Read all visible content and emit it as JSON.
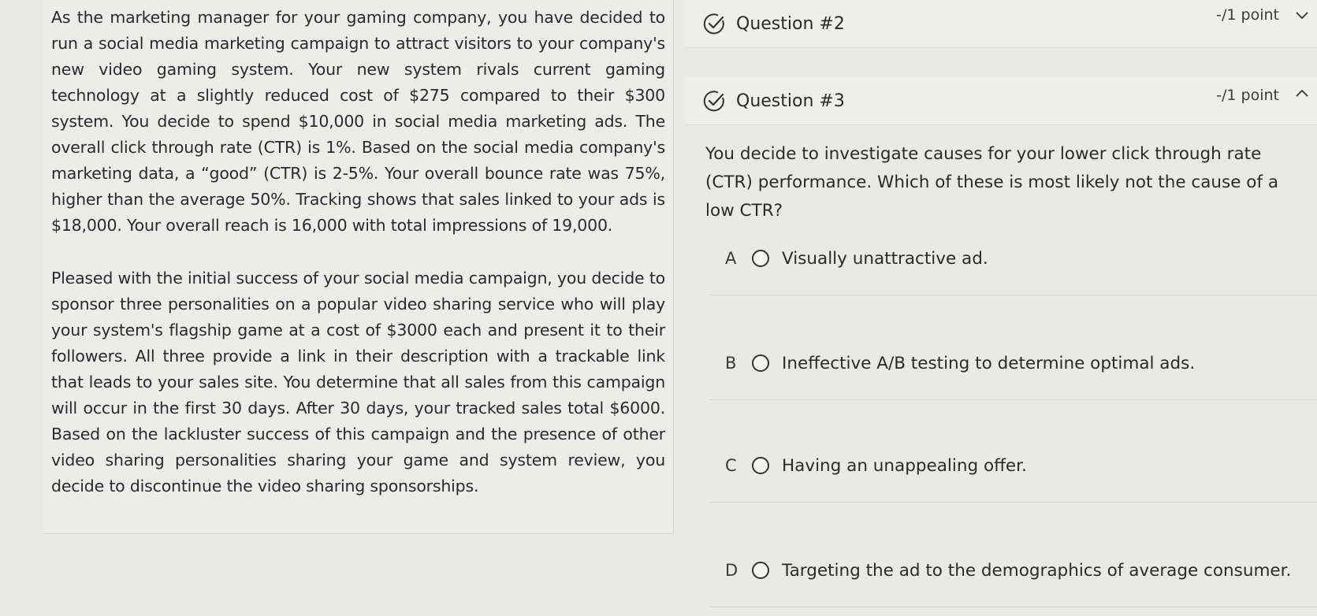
{
  "passage": {
    "paragraph_1": "As the marketing manager for your gaming company, you have decided to run a social media marketing campaign to attract visitors to your company's new video gaming system. Your new system rivals current gaming technology at a slightly reduced cost of $275 compared to their $300 system. You decide to spend $10,000 in social media marketing ads. The overall click through rate (CTR) is 1%. Based on the social media company's marketing data, a “good” (CTR) is 2-5%. Your overall bounce rate was 75%, higher than the average 50%. Tracking shows that sales linked to your ads is $18,000. Your overall reach is 16,000 with total impressions of 19,000.",
    "paragraph_2": "Pleased with the initial success of your social media campaign, you decide to sponsor three personalities on a popular video sharing service who will play your system's flagship game at a cost of $3000 each and present it to their followers. All three provide a link in their description with a trackable link that leads to your sales site. You determine that all sales from this campaign will occur in the first 30 days. After 30 days, your tracked sales total $6000. Based on the lackluster success of this campaign and the presence of other video sharing personalities sharing your game and system review, you decide to discontinue the video sharing sponsorships."
  },
  "questions": [
    {
      "title": "Question #2",
      "points": "-/1 point",
      "status_icon": "check-circle-icon",
      "toggle_icon": "chevron-down-icon"
    },
    {
      "title": "Question #3",
      "points": "-/1 point",
      "status_icon": "check-circle-icon",
      "toggle_icon": "chevron-up-icon"
    }
  ],
  "current_question": {
    "prompt": "You decide to investigate causes for your lower click through rate (CTR) performance. Which of these is most likely not the cause of a low CTR?",
    "choices": [
      {
        "letter": "A",
        "text": "Visually unattractive ad."
      },
      {
        "letter": "B",
        "text": "Ineffective A/B testing to determine optimal ads."
      },
      {
        "letter": "C",
        "text": "Having an unappealing offer."
      },
      {
        "letter": "D",
        "text": "Targeting the ad to the demographics of average consumer."
      }
    ]
  },
  "colors": {
    "background": "#e9e9e6",
    "text": "#2a2a2a",
    "check_icon": "#333333"
  }
}
